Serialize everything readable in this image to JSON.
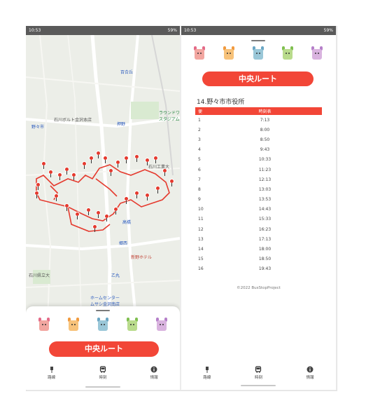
{
  "left_screen": {
    "status": {
      "time": "10:53",
      "battery": "59%"
    },
    "map_labels": [
      {
        "text": "百合丘",
        "color": "blue"
      },
      {
        "text": "野々市",
        "color": "blue"
      },
      {
        "text": "石川ボルト金沢本店",
        "color": "gray"
      },
      {
        "text": "押野",
        "color": "blue"
      },
      {
        "text": "ラウンドワン\nスタジアム",
        "color": "green"
      },
      {
        "text": "石川工業大",
        "color": "gray"
      },
      {
        "text": "高橋",
        "color": "blue"
      },
      {
        "text": "郷西",
        "color": "blue"
      },
      {
        "text": "新野ホテル",
        "color": "red"
      },
      {
        "text": "石川県立大",
        "color": "gray"
      },
      {
        "text": "乙丸",
        "color": "blue"
      },
      {
        "text": "ホームセンター\nムサシ金沢南店",
        "color": "blue"
      }
    ],
    "route_button": "中央ルート",
    "nav": [
      {
        "icon": "bus-stop-icon",
        "label": "路線"
      },
      {
        "icon": "bus-icon",
        "label": "時刻"
      },
      {
        "icon": "info-icon",
        "label": "情報"
      }
    ]
  },
  "right_screen": {
    "status": {
      "time": "10:53",
      "battery": "59%"
    },
    "route_button": "中央ルート",
    "stop_title": "14.野々市市役所",
    "table_headers": [
      "便",
      "時刻表"
    ],
    "timetable": [
      {
        "no": "1",
        "time": "7:13"
      },
      {
        "no": "2",
        "time": "8:00"
      },
      {
        "no": "3",
        "time": "8:50"
      },
      {
        "no": "4",
        "time": "9:43"
      },
      {
        "no": "5",
        "time": "10:33"
      },
      {
        "no": "6",
        "time": "11:23"
      },
      {
        "no": "7",
        "time": "12:13"
      },
      {
        "no": "8",
        "time": "13:03"
      },
      {
        "no": "9",
        "time": "13:53"
      },
      {
        "no": "10",
        "time": "14:43"
      },
      {
        "no": "11",
        "time": "15:33"
      },
      {
        "no": "12",
        "time": "16:23"
      },
      {
        "no": "13",
        "time": "17:13"
      },
      {
        "no": "14",
        "time": "18:00"
      },
      {
        "no": "15",
        "time": "18:50"
      },
      {
        "no": "16",
        "time": "19:43"
      }
    ],
    "copyright": "©2022 BusStopProject",
    "nav": [
      {
        "icon": "bus-stop-icon",
        "label": "路線"
      },
      {
        "icon": "bus-icon",
        "label": "時刻"
      },
      {
        "icon": "info-icon",
        "label": "情報"
      }
    ]
  },
  "characters": [
    {
      "name": "mascot-pink",
      "color": "#f2a6a0",
      "ear": "#e46a88"
    },
    {
      "name": "mascot-orange",
      "color": "#f7c27a",
      "ear": "#f19a3e"
    },
    {
      "name": "mascot-blue",
      "color": "#9ac7d8",
      "ear": "#6aa6c4"
    },
    {
      "name": "mascot-green",
      "color": "#b9db8c",
      "ear": "#7fbf4f"
    },
    {
      "name": "mascot-purple",
      "color": "#d9b3df",
      "ear": "#b57fc9"
    }
  ],
  "colors": {
    "accent": "#f24637",
    "route_line": "#e53a2e"
  }
}
